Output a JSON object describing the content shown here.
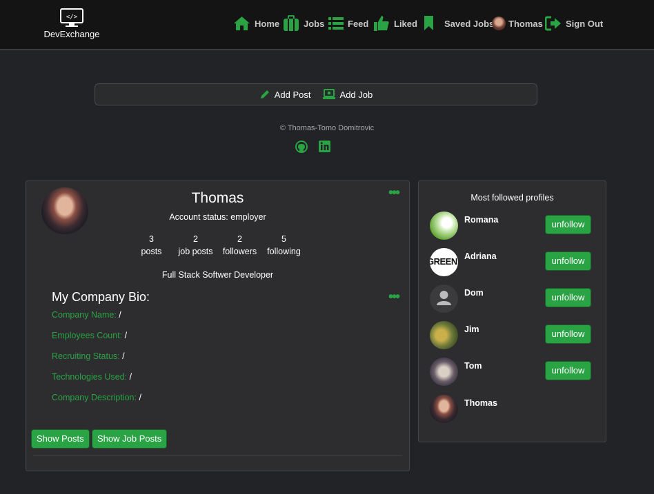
{
  "brand": {
    "name": "DevExchange",
    "logo_text": "</>"
  },
  "nav": {
    "home": "Home",
    "jobs": "Jobs",
    "feed": "Feed",
    "liked": "Liked",
    "saved": "Saved Jobs",
    "user": "Thomas",
    "signout": "Sign Out"
  },
  "actions": {
    "add_post": "Add Post",
    "add_job": "Add Job"
  },
  "footer": {
    "copyright": "© Thomas-Tomo Domitrovic"
  },
  "profile": {
    "name": "Thomas",
    "status": "Account status: employer",
    "stats": [
      {
        "value": "3",
        "label": "posts"
      },
      {
        "value": "2",
        "label": "job posts"
      },
      {
        "value": "2",
        "label": "followers"
      },
      {
        "value": "5",
        "label": "following"
      }
    ],
    "title": "Full Stack Softwer Developer",
    "bio_heading": "My Company Bio:",
    "bio": [
      {
        "key": "Company Name:",
        "value": " /"
      },
      {
        "key": "Employees Count:",
        "value": " /"
      },
      {
        "key": "Recruiting Status:",
        "value": " /"
      },
      {
        "key": "Technologies Used:",
        "value": " /"
      },
      {
        "key": "Company Description:",
        "value": " /"
      }
    ],
    "show_posts": "Show Posts",
    "show_job_posts": "Show Job Posts"
  },
  "followed": {
    "title": "Most followed profiles",
    "unfollow_label": "unfollow",
    "items": [
      {
        "name": "Romana",
        "avatar_text": ""
      },
      {
        "name": "Adriana",
        "avatar_text": "GREEN"
      },
      {
        "name": "Dom",
        "avatar_text": ""
      },
      {
        "name": "Jim",
        "avatar_text": ""
      },
      {
        "name": "Tom",
        "avatar_text": ""
      },
      {
        "name": "Thomas",
        "avatar_text": ""
      }
    ]
  },
  "colors": {
    "accent": "#2aa345",
    "background": "#222326",
    "card": "#2d2d2f",
    "navbar": "#141414"
  }
}
